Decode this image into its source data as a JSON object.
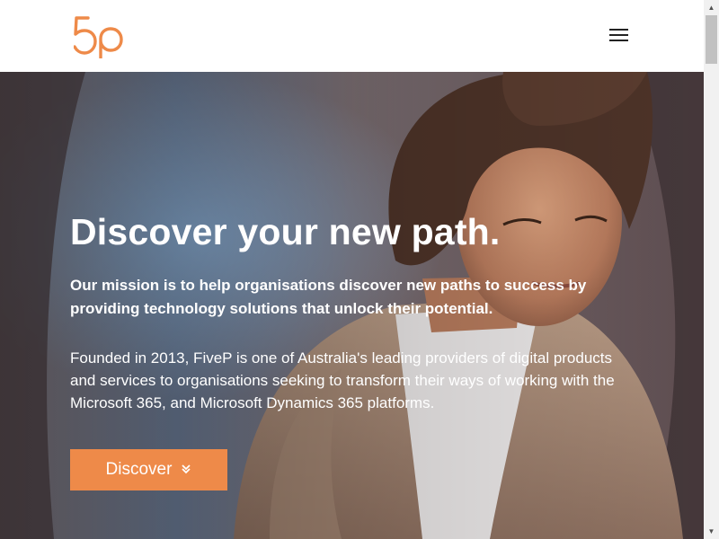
{
  "header": {
    "logo_text": "5p",
    "menu_icon": "hamburger-menu-icon"
  },
  "hero": {
    "title": "Discover your new path.",
    "mission": "Our mission is to help organisations discover new paths to success by providing technology solutions that unlock their potential.",
    "about": "Founded in 2013, FiveP is one of Australia's leading providers of digital products and services to organisations seeking to transform their ways of working with the Microsoft 365, and Microsoft Dynamics 365 platforms.",
    "cta_label": "Discover",
    "cta_icon": "double-chevron-down-icon",
    "cta_glyph": "⌄⌄"
  },
  "scrollbar": {
    "up_glyph": "▲",
    "down_glyph": "▼"
  },
  "colors": {
    "brand_orange": "#ee8a49",
    "header_bg": "#ffffff",
    "hero_text": "#ffffff"
  }
}
